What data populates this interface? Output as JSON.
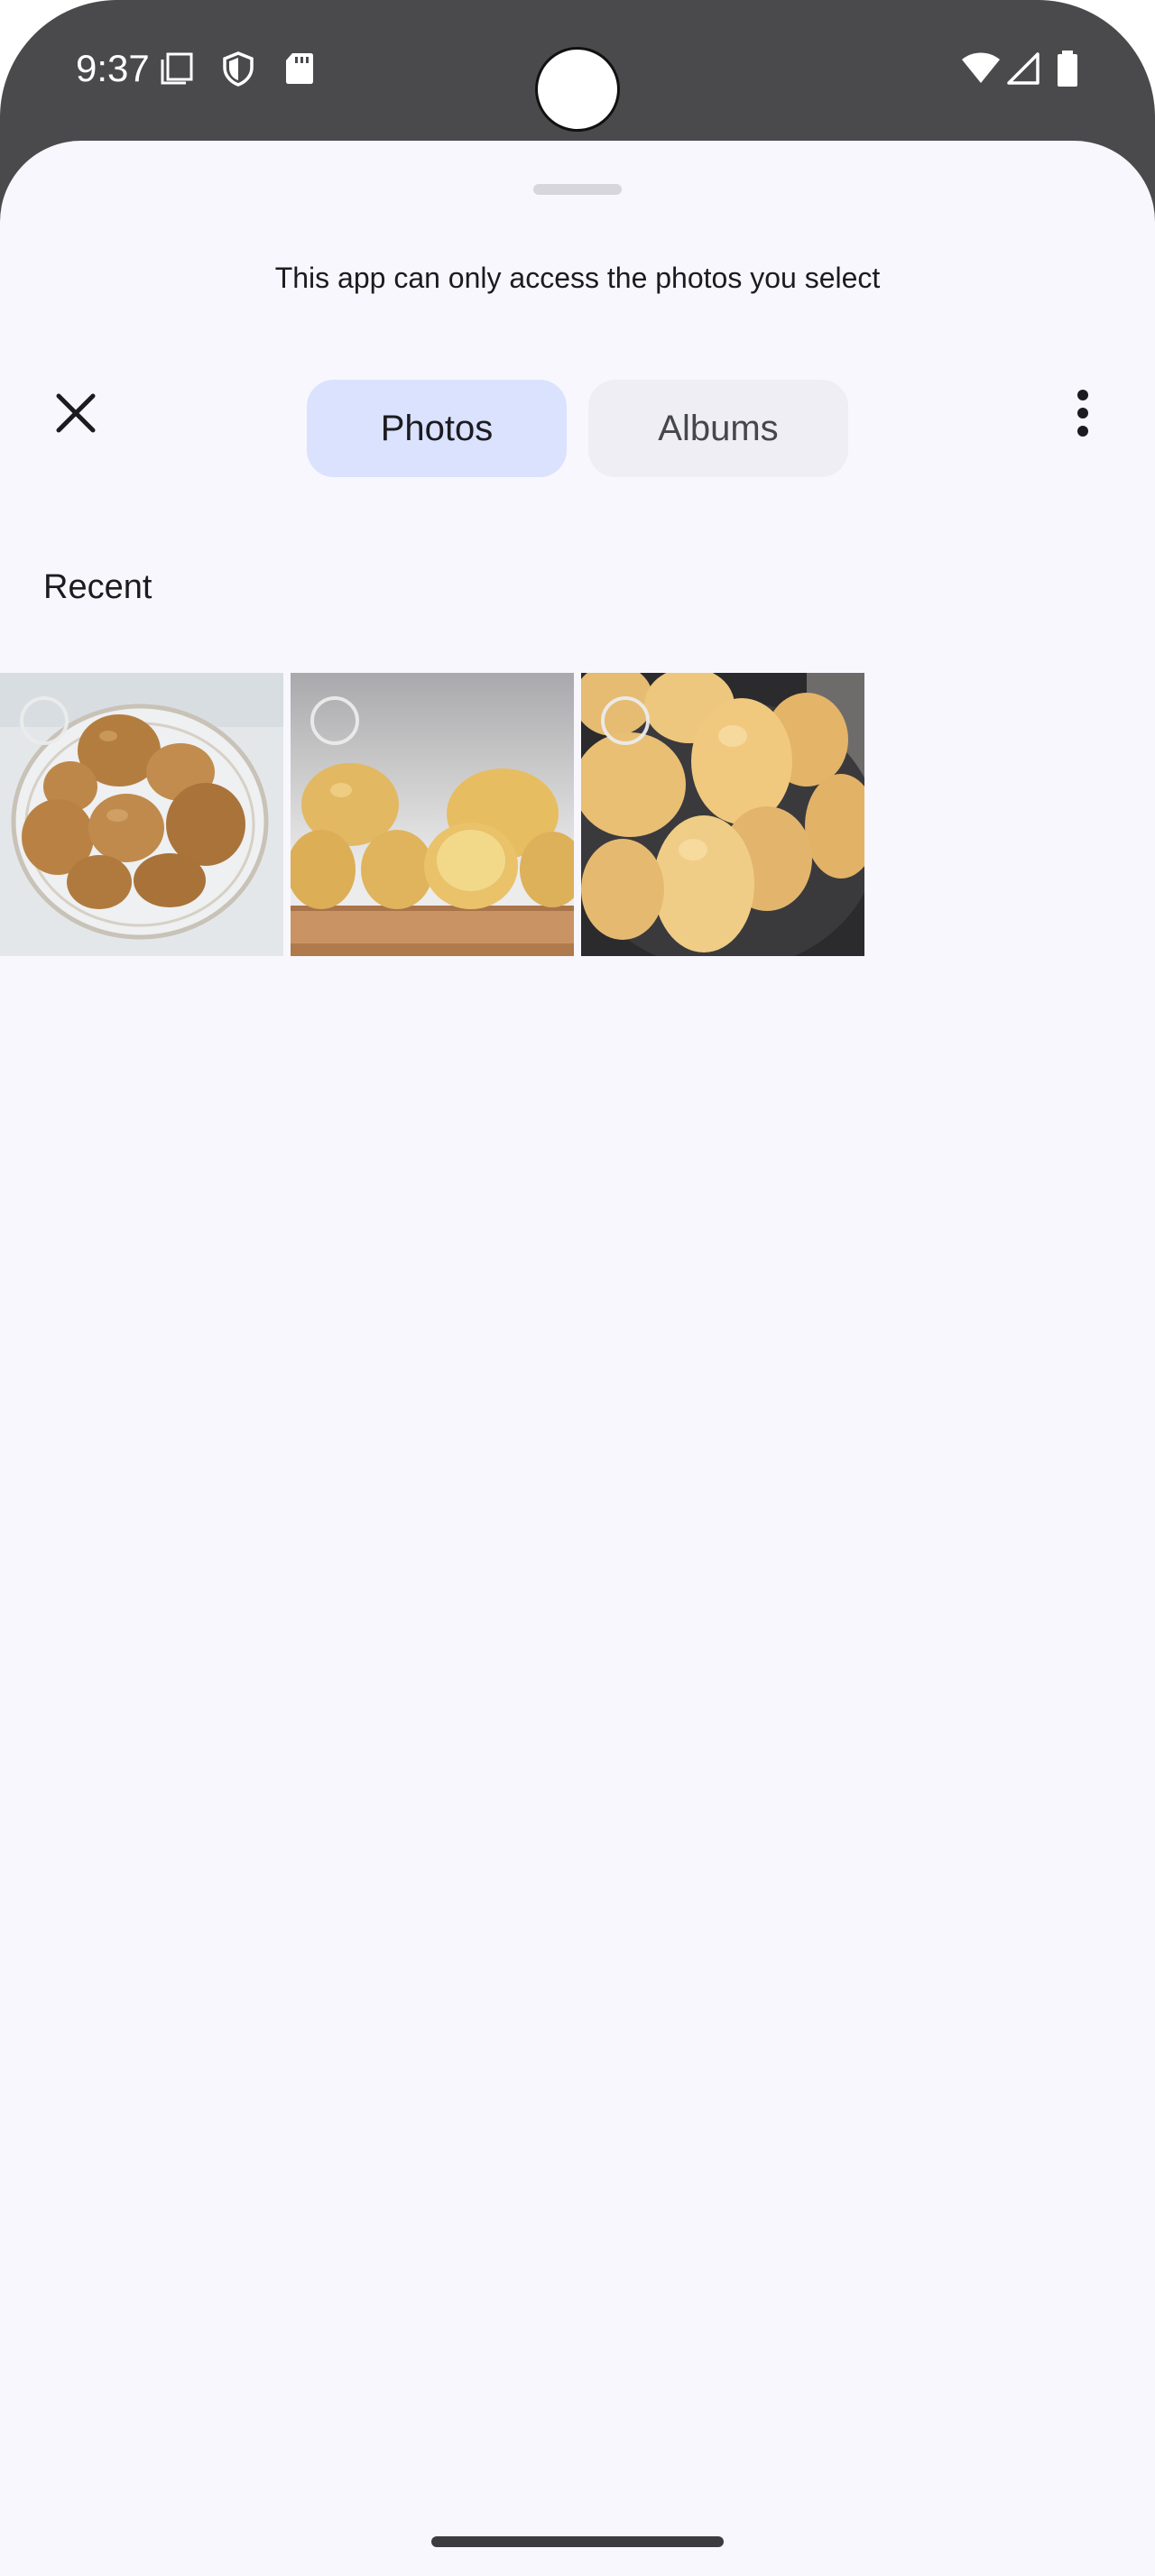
{
  "status_bar": {
    "time": "9:37",
    "left_icons": [
      "screenshot-icon",
      "vpn-shield-icon",
      "sd-card-icon"
    ],
    "right_icons": [
      "wifi-icon",
      "cellular-signal-icon",
      "battery-icon"
    ]
  },
  "sheet": {
    "notice": "This app can only access the photos you select",
    "tabs": [
      {
        "label": "Photos",
        "selected": true
      },
      {
        "label": "Albums",
        "selected": false
      }
    ],
    "section_title": "Recent",
    "photos": [
      {
        "name": "potatoes in glass bowl",
        "selected": false
      },
      {
        "name": "potatoes on wooden board",
        "selected": false
      },
      {
        "name": "potatoes in dark pan",
        "selected": false
      }
    ]
  },
  "colors": {
    "status_bar": "#4a4a4c",
    "sheet_background": "#f8f7fd",
    "selected_tab": "#dae2fe",
    "unselected_tab": "#efeef4"
  }
}
